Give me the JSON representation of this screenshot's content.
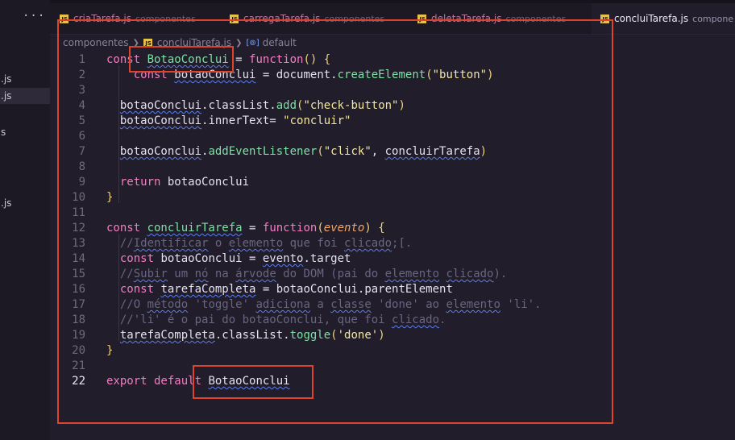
{
  "sidebar": {
    "dots": "···",
    "items": [
      ".js",
      ".js",
      "s",
      ".js"
    ]
  },
  "tabs": [
    {
      "name": "criaTarefa.js",
      "dir": "componentes",
      "active": false
    },
    {
      "name": "carregaTarefa.js",
      "dir": "componentes",
      "active": false
    },
    {
      "name": "deletaTarefa.js",
      "dir": "componentes",
      "active": false
    },
    {
      "name": "concluiTarefa.js",
      "dir": "compone",
      "active": true
    }
  ],
  "breadcrumb": {
    "folder": "componentes",
    "file": "concluiTarefa.js",
    "symbol": "default"
  },
  "code_lines": [
    {
      "n": "1",
      "tokens": [
        [
          "kw",
          "const "
        ],
        [
          "fn sq",
          "BotaoConclui"
        ],
        [
          "txt",
          " = "
        ],
        [
          "kw",
          "function"
        ],
        [
          "pr",
          "() {"
        ]
      ]
    },
    {
      "n": "2",
      "tokens": [
        [
          "txt",
          "    "
        ],
        [
          "kw",
          "const "
        ],
        [
          "txt sq",
          "botaoConclui"
        ],
        [
          "txt",
          " = "
        ],
        [
          "txt",
          "document."
        ],
        [
          "fn",
          "createElement"
        ],
        [
          "pr",
          "("
        ],
        [
          "str",
          "\"button\""
        ],
        [
          "pr",
          ")"
        ]
      ]
    },
    {
      "n": "3",
      "tokens": []
    },
    {
      "n": "4",
      "tokens": [
        [
          "txt",
          "  "
        ],
        [
          "txt sq",
          "botaoConclui"
        ],
        [
          "txt",
          "."
        ],
        [
          "txt",
          "classList."
        ],
        [
          "fn",
          "add"
        ],
        [
          "pr",
          "("
        ],
        [
          "str",
          "\"check-button\""
        ],
        [
          "pr",
          ")"
        ]
      ]
    },
    {
      "n": "5",
      "tokens": [
        [
          "txt",
          "  "
        ],
        [
          "txt sq",
          "botaoConclui"
        ],
        [
          "txt",
          ".innerText= "
        ],
        [
          "str",
          "\"concluir\""
        ]
      ]
    },
    {
      "n": "6",
      "tokens": []
    },
    {
      "n": "7",
      "tokens": [
        [
          "txt",
          "  "
        ],
        [
          "txt sq",
          "botaoConclui"
        ],
        [
          "txt",
          "."
        ],
        [
          "fn",
          "addEventListener"
        ],
        [
          "pr",
          "("
        ],
        [
          "str",
          "\"click\""
        ],
        [
          "txt",
          ", "
        ],
        [
          "txt sq",
          "concluirTarefa"
        ],
        [
          "pr",
          ")"
        ]
      ]
    },
    {
      "n": "8",
      "tokens": []
    },
    {
      "n": "9",
      "tokens": [
        [
          "txt",
          "  "
        ],
        [
          "kw",
          "return "
        ],
        [
          "txt",
          "botaoConclui"
        ]
      ]
    },
    {
      "n": "10",
      "tokens": [
        [
          "pr",
          "}"
        ]
      ]
    },
    {
      "n": "11",
      "tokens": []
    },
    {
      "n": "12",
      "tokens": [
        [
          "kw",
          "const "
        ],
        [
          "fn sq",
          "concluirTarefa"
        ],
        [
          "txt",
          " = "
        ],
        [
          "kw",
          "function"
        ],
        [
          "pr",
          "("
        ],
        [
          "param",
          "evento"
        ],
        [
          "pr",
          ") {"
        ]
      ]
    },
    {
      "n": "13",
      "tokens": [
        [
          "txt",
          "  "
        ],
        [
          "cmt",
          "//"
        ],
        [
          "cmt sq",
          "Identificar"
        ],
        [
          "cmt",
          " o "
        ],
        [
          "cmt sq",
          "elemento"
        ],
        [
          "cmt",
          " que foi "
        ],
        [
          "cmt sq",
          "clicado"
        ],
        [
          "cmt",
          ";[."
        ]
      ]
    },
    {
      "n": "14",
      "tokens": [
        [
          "txt",
          "  "
        ],
        [
          "kw",
          "const "
        ],
        [
          "txt",
          "botaoConclui = "
        ],
        [
          "txt sq",
          "evento"
        ],
        [
          "txt",
          ".target"
        ]
      ]
    },
    {
      "n": "15",
      "tokens": [
        [
          "txt",
          "  "
        ],
        [
          "cmt",
          "//"
        ],
        [
          "cmt sq",
          "Subir"
        ],
        [
          "cmt",
          " um "
        ],
        [
          "cmt sq",
          "nó"
        ],
        [
          "cmt",
          " na "
        ],
        [
          "cmt sq",
          "árvode"
        ],
        [
          "cmt",
          " do DOM (pai do "
        ],
        [
          "cmt sq",
          "elemento"
        ],
        [
          "cmt",
          " "
        ],
        [
          "cmt sq",
          "clicado"
        ],
        [
          "cmt",
          ")."
        ]
      ]
    },
    {
      "n": "16",
      "tokens": [
        [
          "txt",
          "  "
        ],
        [
          "kw",
          "const "
        ],
        [
          "txt sq",
          "tarefaCompleta"
        ],
        [
          "txt",
          " = botaoConclui.parentElement"
        ]
      ]
    },
    {
      "n": "17",
      "tokens": [
        [
          "txt",
          "  "
        ],
        [
          "cmt",
          "//O "
        ],
        [
          "cmt sq",
          "método"
        ],
        [
          "cmt",
          " 'toggle' "
        ],
        [
          "cmt sq",
          "adiciona"
        ],
        [
          "cmt",
          " a "
        ],
        [
          "cmt sq",
          "classe"
        ],
        [
          "cmt",
          " 'done' ao "
        ],
        [
          "cmt sq",
          "elemento"
        ],
        [
          "cmt",
          " 'li'."
        ]
      ]
    },
    {
      "n": "18",
      "tokens": [
        [
          "txt",
          "  "
        ],
        [
          "cmt",
          "//'li' é o pai do botaoConclui, que foi "
        ],
        [
          "cmt sq",
          "clicado"
        ],
        [
          "cmt",
          "."
        ]
      ]
    },
    {
      "n": "19",
      "tokens": [
        [
          "txt",
          "  "
        ],
        [
          "txt sq",
          "tarefaCompleta"
        ],
        [
          "txt",
          ".classList."
        ],
        [
          "fn",
          "toggle"
        ],
        [
          "pr",
          "("
        ],
        [
          "str",
          "'done'"
        ],
        [
          "pr",
          ")"
        ]
      ]
    },
    {
      "n": "20",
      "tokens": [
        [
          "pr",
          "}"
        ]
      ]
    },
    {
      "n": "21",
      "tokens": []
    },
    {
      "n": "22",
      "tokens": [
        [
          "kw",
          "export default "
        ],
        [
          "txt sq",
          "BotaoConclui"
        ]
      ]
    }
  ],
  "current_line": "22",
  "colors": {
    "highlight_box": "#e0432c",
    "background": "#211d2b",
    "keyword": "#f27ec2",
    "function": "#7ee0a3",
    "string": "#f3e6a0"
  }
}
